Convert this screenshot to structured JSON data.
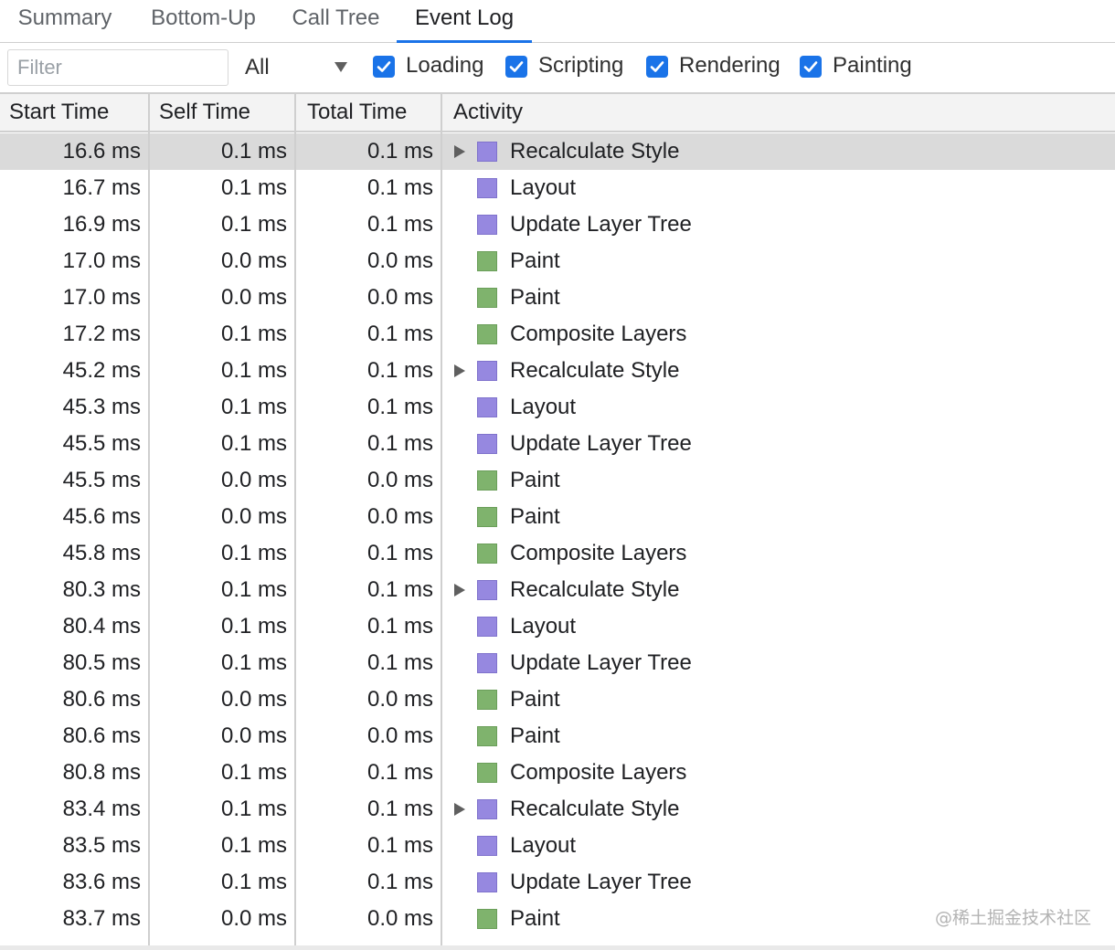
{
  "tabs": [
    {
      "label": "Summary",
      "active": false
    },
    {
      "label": "Bottom-Up",
      "active": false
    },
    {
      "label": "Call Tree",
      "active": false
    },
    {
      "label": "Event Log",
      "active": true
    }
  ],
  "toolbar": {
    "filter_placeholder": "Filter",
    "filter_value": "",
    "duration_select": "All",
    "checkboxes": [
      {
        "label": "Loading",
        "checked": true
      },
      {
        "label": "Scripting",
        "checked": true
      },
      {
        "label": "Rendering",
        "checked": true
      },
      {
        "label": "Painting",
        "checked": true
      }
    ]
  },
  "table": {
    "columns": [
      "Start Time",
      "Self Time",
      "Total Time",
      "Activity"
    ],
    "rows": [
      {
        "start": "16.6 ms",
        "self": "0.1 ms",
        "total": "0.1 ms",
        "activity": "Recalculate Style",
        "category": "scripting",
        "expandable": true,
        "selected": true
      },
      {
        "start": "16.7 ms",
        "self": "0.1 ms",
        "total": "0.1 ms",
        "activity": "Layout",
        "category": "scripting",
        "expandable": false,
        "selected": false
      },
      {
        "start": "16.9 ms",
        "self": "0.1 ms",
        "total": "0.1 ms",
        "activity": "Update Layer Tree",
        "category": "scripting",
        "expandable": false,
        "selected": false
      },
      {
        "start": "17.0 ms",
        "self": "0.0 ms",
        "total": "0.0 ms",
        "activity": "Paint",
        "category": "painting",
        "expandable": false,
        "selected": false
      },
      {
        "start": "17.0 ms",
        "self": "0.0 ms",
        "total": "0.0 ms",
        "activity": "Paint",
        "category": "painting",
        "expandable": false,
        "selected": false
      },
      {
        "start": "17.2 ms",
        "self": "0.1 ms",
        "total": "0.1 ms",
        "activity": "Composite Layers",
        "category": "painting",
        "expandable": false,
        "selected": false
      },
      {
        "start": "45.2 ms",
        "self": "0.1 ms",
        "total": "0.1 ms",
        "activity": "Recalculate Style",
        "category": "scripting",
        "expandable": true,
        "selected": false
      },
      {
        "start": "45.3 ms",
        "self": "0.1 ms",
        "total": "0.1 ms",
        "activity": "Layout",
        "category": "scripting",
        "expandable": false,
        "selected": false
      },
      {
        "start": "45.5 ms",
        "self": "0.1 ms",
        "total": "0.1 ms",
        "activity": "Update Layer Tree",
        "category": "scripting",
        "expandable": false,
        "selected": false
      },
      {
        "start": "45.5 ms",
        "self": "0.0 ms",
        "total": "0.0 ms",
        "activity": "Paint",
        "category": "painting",
        "expandable": false,
        "selected": false
      },
      {
        "start": "45.6 ms",
        "self": "0.0 ms",
        "total": "0.0 ms",
        "activity": "Paint",
        "category": "painting",
        "expandable": false,
        "selected": false
      },
      {
        "start": "45.8 ms",
        "self": "0.1 ms",
        "total": "0.1 ms",
        "activity": "Composite Layers",
        "category": "painting",
        "expandable": false,
        "selected": false
      },
      {
        "start": "80.3 ms",
        "self": "0.1 ms",
        "total": "0.1 ms",
        "activity": "Recalculate Style",
        "category": "scripting",
        "expandable": true,
        "selected": false
      },
      {
        "start": "80.4 ms",
        "self": "0.1 ms",
        "total": "0.1 ms",
        "activity": "Layout",
        "category": "scripting",
        "expandable": false,
        "selected": false
      },
      {
        "start": "80.5 ms",
        "self": "0.1 ms",
        "total": "0.1 ms",
        "activity": "Update Layer Tree",
        "category": "scripting",
        "expandable": false,
        "selected": false
      },
      {
        "start": "80.6 ms",
        "self": "0.0 ms",
        "total": "0.0 ms",
        "activity": "Paint",
        "category": "painting",
        "expandable": false,
        "selected": false
      },
      {
        "start": "80.6 ms",
        "self": "0.0 ms",
        "total": "0.0 ms",
        "activity": "Paint",
        "category": "painting",
        "expandable": false,
        "selected": false
      },
      {
        "start": "80.8 ms",
        "self": "0.1 ms",
        "total": "0.1 ms",
        "activity": "Composite Layers",
        "category": "painting",
        "expandable": false,
        "selected": false
      },
      {
        "start": "83.4 ms",
        "self": "0.1 ms",
        "total": "0.1 ms",
        "activity": "Recalculate Style",
        "category": "scripting",
        "expandable": true,
        "selected": false
      },
      {
        "start": "83.5 ms",
        "self": "0.1 ms",
        "total": "0.1 ms",
        "activity": "Layout",
        "category": "scripting",
        "expandable": false,
        "selected": false
      },
      {
        "start": "83.6 ms",
        "self": "0.1 ms",
        "total": "0.1 ms",
        "activity": "Update Layer Tree",
        "category": "scripting",
        "expandable": false,
        "selected": false
      },
      {
        "start": "83.7 ms",
        "self": "0.0 ms",
        "total": "0.0 ms",
        "activity": "Paint",
        "category": "painting",
        "expandable": false,
        "selected": false
      }
    ]
  },
  "watermark": "@稀土掘金技术社区",
  "colors": {
    "accent": "#1a73e8",
    "scripting": "#9688e0",
    "painting": "#7fb36d",
    "selected_row": "#dadada"
  }
}
